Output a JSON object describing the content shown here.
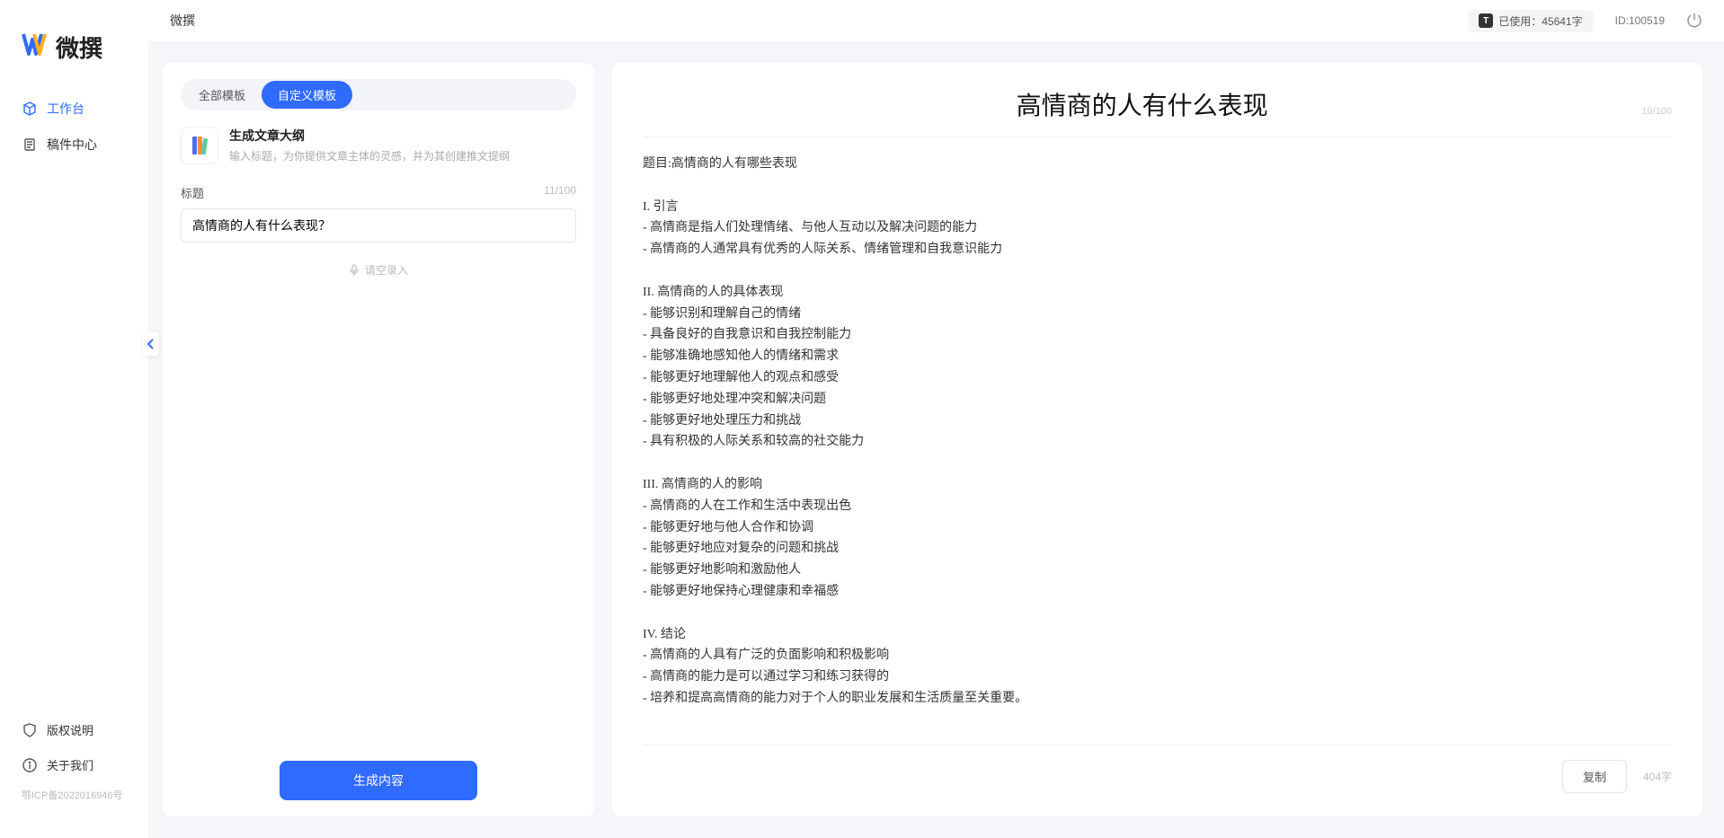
{
  "app": {
    "name": "微撰"
  },
  "topbar": {
    "title": "微撰",
    "usage_label": "已使用：45641字",
    "id_label": "ID:100519"
  },
  "sidebar": {
    "items": [
      {
        "label": "工作台",
        "icon": "cube"
      },
      {
        "label": "稿件中心",
        "icon": "doc"
      }
    ],
    "footer": [
      {
        "label": "版权说明",
        "icon": "shield"
      },
      {
        "label": "关于我们",
        "icon": "info"
      }
    ],
    "icp": "鄂ICP备2022016946号"
  },
  "left": {
    "tabs": [
      {
        "label": "全部模板",
        "active": false
      },
      {
        "label": "自定义模板",
        "active": true
      }
    ],
    "template": {
      "title": "生成文章大纲",
      "desc": "输入标题，为你提供文章主体的灵感，并为其创建推文提纲"
    },
    "field": {
      "label": "标题",
      "value": "高情商的人有什么表现？",
      "count": "11/100"
    },
    "voice_label": "请空录入",
    "generate_label": "生成内容"
  },
  "right": {
    "title": "高情商的人有什么表现",
    "title_count": "10/100",
    "body": "题目:高情商的人有哪些表现\n\nI. 引言\n- 高情商是指人们处理情绪、与他人互动以及解决问题的能力\n- 高情商的人通常具有优秀的人际关系、情绪管理和自我意识能力\n\nII. 高情商的人的具体表现\n- 能够识别和理解自己的情绪\n- 具备良好的自我意识和自我控制能力\n- 能够准确地感知他人的情绪和需求\n- 能够更好地理解他人的观点和感受\n- 能够更好地处理冲突和解决问题\n- 能够更好地处理压力和挑战\n- 具有积极的人际关系和较高的社交能力\n\nIII. 高情商的人的影响\n- 高情商的人在工作和生活中表现出色\n- 能够更好地与他人合作和协调\n- 能够更好地应对复杂的问题和挑战\n- 能够更好地影响和激励他人\n- 能够更好地保持心理健康和幸福感\n\nIV. 结论\n- 高情商的人具有广泛的负面影响和积极影响\n- 高情商的能力是可以通过学习和练习获得的\n- 培养和提高高情商的能力对于个人的职业发展和生活质量至关重要。",
    "copy_label": "复制",
    "char_count": "404字"
  }
}
